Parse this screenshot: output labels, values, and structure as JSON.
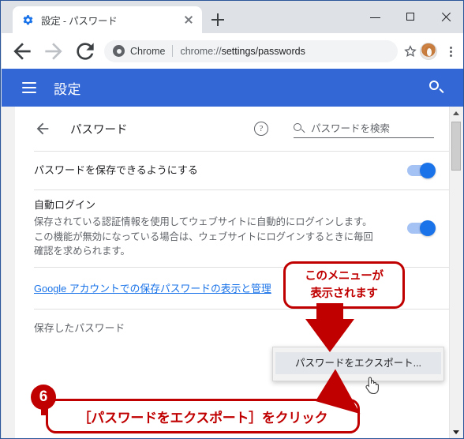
{
  "window": {
    "minimize_label": "最小化",
    "maximize_label": "最大化",
    "close_label": "閉じる"
  },
  "tab": {
    "favicon": "gear-icon",
    "title": "設定 - パスワード",
    "close_label": "×",
    "new_tab_label": "+"
  },
  "toolbar": {
    "back_label": "戻る",
    "forward_label": "進む",
    "reload_label": "再読み込み",
    "chip_label": "Chrome",
    "url_scheme": "chrome://",
    "url_path": "settings/passwords",
    "url_full": "chrome://settings/passwords",
    "bookmark_label": "ブックマーク",
    "profile_label": "プロフィール",
    "menu_label": "Google Chrome の設定"
  },
  "settings_header": {
    "menu_label": "メインメニュー",
    "title": "設定",
    "search_label": "検索"
  },
  "page": {
    "back_label": "戻る",
    "title": "パスワード",
    "help_label": "?",
    "search_placeholder": "パスワードを検索",
    "rows": [
      {
        "title": "パスワードを保存できるようにする",
        "desc": "",
        "toggle": "on"
      },
      {
        "title": "自動ログイン",
        "desc": "保存されている認証情報を使用してウェブサイトに自動的にログインします。\nこの機能が無効になっている場合は、ウェブサイトにログインするときに毎回\n確認を求められます。",
        "toggle": "on"
      }
    ],
    "google_link": "Google アカウントでの保存パスワードの表示と管理",
    "saved_passwords_label": "保存したパスワード"
  },
  "context_menu": {
    "items": [
      {
        "label": "パスワードをエクスポート...",
        "highlighted": true
      }
    ]
  },
  "callouts": {
    "top": {
      "line1": "このメニューが",
      "line2": "表示されます"
    },
    "bottom": {
      "step_number": "6",
      "text": "［パスワードをエクスポート］をクリック"
    }
  },
  "colors": {
    "settings_header_blue": "#3367d6",
    "toggle_on_blue": "#1a73e8",
    "link_blue": "#1a73e8",
    "callout_red": "#c00000",
    "menu_highlight": "#e3e6ea"
  }
}
